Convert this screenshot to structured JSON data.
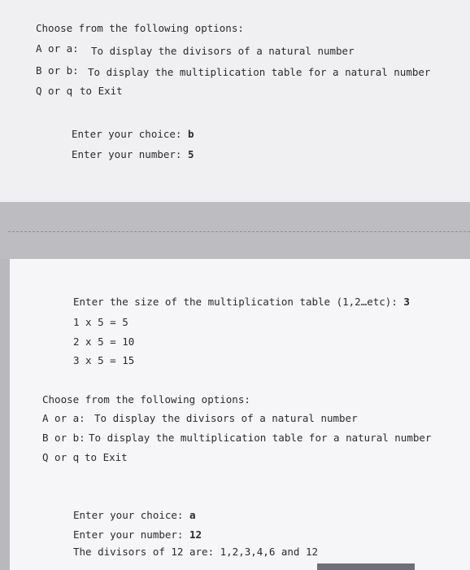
{
  "session1": {
    "menu_title": "Choose from the following options:",
    "menu_items": [
      {
        "key": "A or a:",
        "desc": "To display the divisors of a natural number"
      },
      {
        "key": "B or b:",
        "desc": "To display the multiplication table for a natural number"
      },
      {
        "key": "Q or q",
        "desc": "to Exit"
      }
    ],
    "choice_prompt": "Enter your choice:",
    "choice_value": "b",
    "number_prompt": "Enter your number:",
    "number_value": "5"
  },
  "session2": {
    "size_prompt": "Enter the size of the multiplication table (1,2…etc):",
    "size_value": "3",
    "table_rows": [
      "1 x 5  =  5",
      "2 x 5  = 10",
      "3 x 5 =  15"
    ],
    "menu_title": "Choose from the following options:",
    "menu_items": [
      {
        "key": "A or a:",
        "desc": "To display the divisors of a natural number"
      },
      {
        "key": "B or b:",
        "desc": "To display the multiplication table for a natural number"
      },
      {
        "key": "Q or q",
        "desc": "to Exit"
      }
    ],
    "choice_prompt": "Enter your choice:",
    "choice_value": "a",
    "number_prompt": "Enter your number:",
    "number_value": "12",
    "result_text": "The divisors of 12 are: 1,2,3,4,6 and 12"
  }
}
